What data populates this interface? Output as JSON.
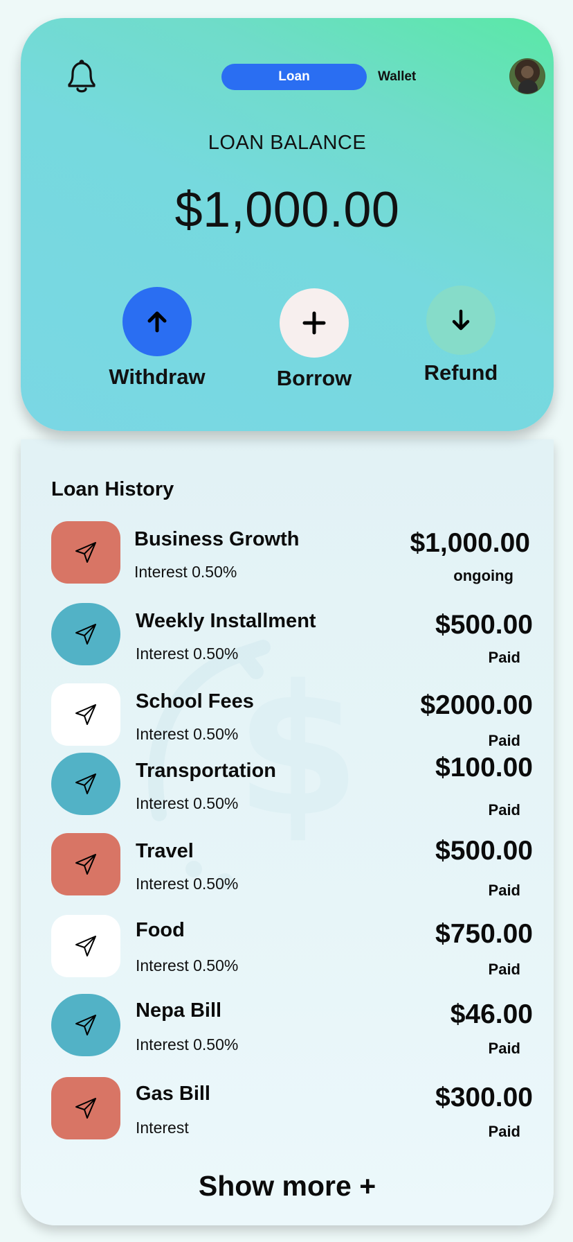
{
  "header": {
    "toggle": {
      "active": "Loan",
      "inactive": "Wallet"
    },
    "balance_label": "LOAN BALANCE",
    "balance_amount": "$1,000.00",
    "actions": [
      {
        "label": "Withdraw",
        "icon": "arrow-up-icon"
      },
      {
        "label": "Borrow",
        "icon": "plus-icon"
      },
      {
        "label": "Refund",
        "icon": "arrow-down-icon"
      }
    ]
  },
  "history": {
    "title": "Loan History",
    "items": [
      {
        "name": "Business Growth",
        "interest": "Interest 0.50%",
        "amount": "$1,000.00",
        "status": "ongoing",
        "icon_style": "coral"
      },
      {
        "name": "Weekly Installment",
        "interest": "Interest  0.50%",
        "amount": "$500.00",
        "status": "Paid",
        "icon_style": "teal"
      },
      {
        "name": "School Fees",
        "interest": "Interest  0.50%",
        "amount": "$2000.00",
        "status": "Paid",
        "icon_style": "white"
      },
      {
        "name": "Transportation",
        "interest": "Interest  0.50%",
        "amount": "$100.00",
        "status": "Paid",
        "icon_style": "teal"
      },
      {
        "name": "Travel",
        "interest": "Interest  0.50%",
        "amount": "$500.00",
        "status": "Paid",
        "icon_style": "coral"
      },
      {
        "name": "Food",
        "interest": "Interest  0.50%",
        "amount": "$750.00",
        "status": "Paid",
        "icon_style": "white"
      },
      {
        "name": "Nepa Bill",
        "interest": "Interest   0.50%",
        "amount": "$46.00",
        "status": "Paid",
        "icon_style": "teal"
      },
      {
        "name": "Gas Bill",
        "interest": "Interest",
        "amount": "$300.00",
        "status": "Paid",
        "icon_style": "coral"
      }
    ],
    "show_more": "Show more +"
  },
  "colors": {
    "accent_blue": "#2a6ef2",
    "coral": "#d87565",
    "teal": "#52b2c6",
    "mint": "#86dcc9"
  }
}
